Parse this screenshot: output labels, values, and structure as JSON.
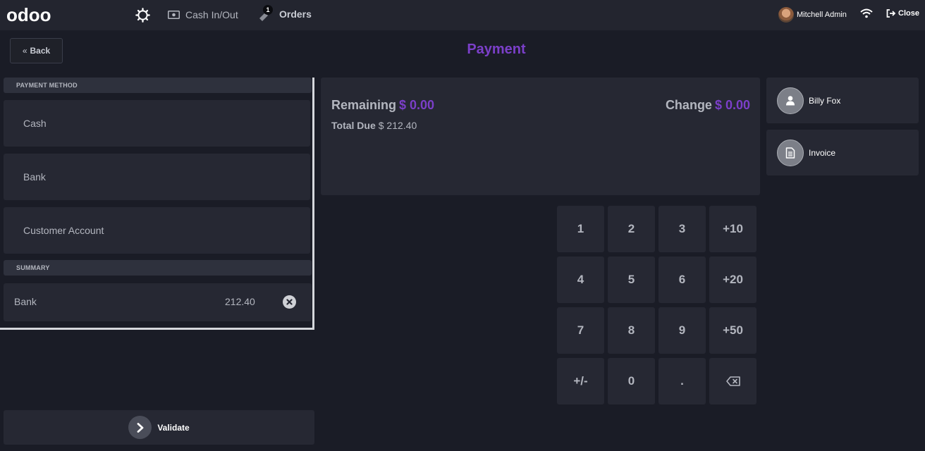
{
  "topbar": {
    "logo": "odoo",
    "cash_in_out": "Cash In/Out",
    "orders_label": "Orders",
    "orders_count": "1",
    "user_name": "Mitchell Admin",
    "close_label": "Close"
  },
  "header": {
    "back_label": "Back",
    "title": "Payment"
  },
  "payment_methods": {
    "heading": "PAYMENT METHOD",
    "items": [
      "Cash",
      "Bank",
      "Customer Account"
    ]
  },
  "summary": {
    "heading": "SUMMARY",
    "line": {
      "name": "Bank",
      "amount": "212.40"
    }
  },
  "totals": {
    "remaining_label": "Remaining",
    "remaining_value": "$ 0.00",
    "change_label": "Change",
    "change_value": "$ 0.00",
    "total_due_label": "Total Due",
    "total_due_value": "$ 212.40"
  },
  "numpad": {
    "keys": [
      "1",
      "2",
      "3",
      "+10",
      "4",
      "5",
      "6",
      "+20",
      "7",
      "8",
      "9",
      "+50",
      "+/-",
      "0",
      "."
    ]
  },
  "side": {
    "customer": "Billy Fox",
    "invoice": "Invoice"
  },
  "validate_label": "Validate",
  "colors": {
    "accent": "#7b3fc9",
    "background": "#1a1c26",
    "panel": "#262833"
  }
}
